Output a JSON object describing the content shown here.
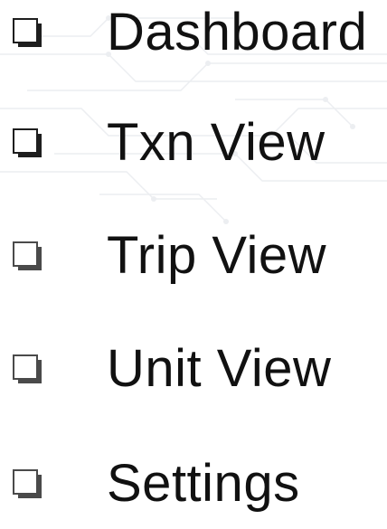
{
  "nav": {
    "items": [
      {
        "label": "Dashboard",
        "icon": "checkbox-icon"
      },
      {
        "label": "Txn View",
        "icon": "checkbox-icon"
      },
      {
        "label": "Trip View",
        "icon": "checkbox-icon"
      },
      {
        "label": "Unit View",
        "icon": "checkbox-icon"
      },
      {
        "label": "Settings",
        "icon": "checkbox-icon"
      }
    ]
  },
  "colors": {
    "text": "#111111",
    "checkbox": "#1e1e1e",
    "background": "#ffffff",
    "circuit_lines": "#e9ecef"
  }
}
